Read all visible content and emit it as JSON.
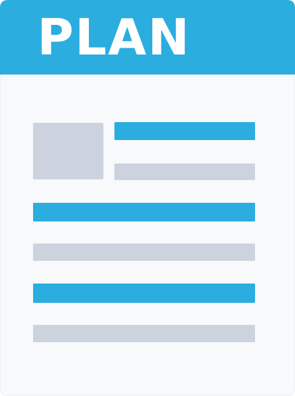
{
  "document_icon": {
    "title": "PLAN",
    "colors": {
      "header": "#2bade0",
      "accent_line": "#2bade0",
      "muted_line": "#ccd3de",
      "thumbnail": "#ccd3de",
      "page": "#f7f9fb",
      "title_text": "#ffffff"
    }
  }
}
